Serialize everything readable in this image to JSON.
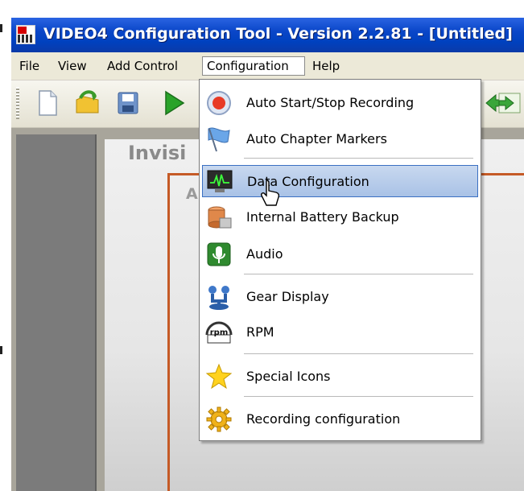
{
  "window": {
    "title": "VIDEO4 Configuration Tool - Version 2.2.81 - [Untitled]"
  },
  "menubar": {
    "items": [
      "File",
      "View",
      "Add Control",
      "Configuration",
      "Help"
    ],
    "open_menu": "Configuration"
  },
  "canvas": {
    "label_top": "Invisi",
    "label_sub": "A"
  },
  "configuration_menu": {
    "items": [
      {
        "label": "Auto Start/Stop Recording",
        "icon": "record-icon"
      },
      {
        "label": "Auto Chapter Markers",
        "icon": "flag-icon"
      },
      {
        "label": "Data Configuration",
        "icon": "data-monitor-icon",
        "highlighted": true
      },
      {
        "label": "Internal Battery Backup",
        "icon": "battery-icon"
      },
      {
        "label": "Audio",
        "icon": "microphone-icon"
      },
      {
        "label": "Gear Display",
        "icon": "gear-shift-icon"
      },
      {
        "label": "RPM",
        "icon": "rpm-gauge-icon"
      },
      {
        "label": "Special Icons",
        "icon": "star-icon"
      },
      {
        "label": "Recording configuration",
        "icon": "gear-icon"
      }
    ]
  },
  "colors": {
    "titlebar": "#0a46c8",
    "menu_highlight": "#b4cae9",
    "canvas_frame": "#c55a26"
  }
}
